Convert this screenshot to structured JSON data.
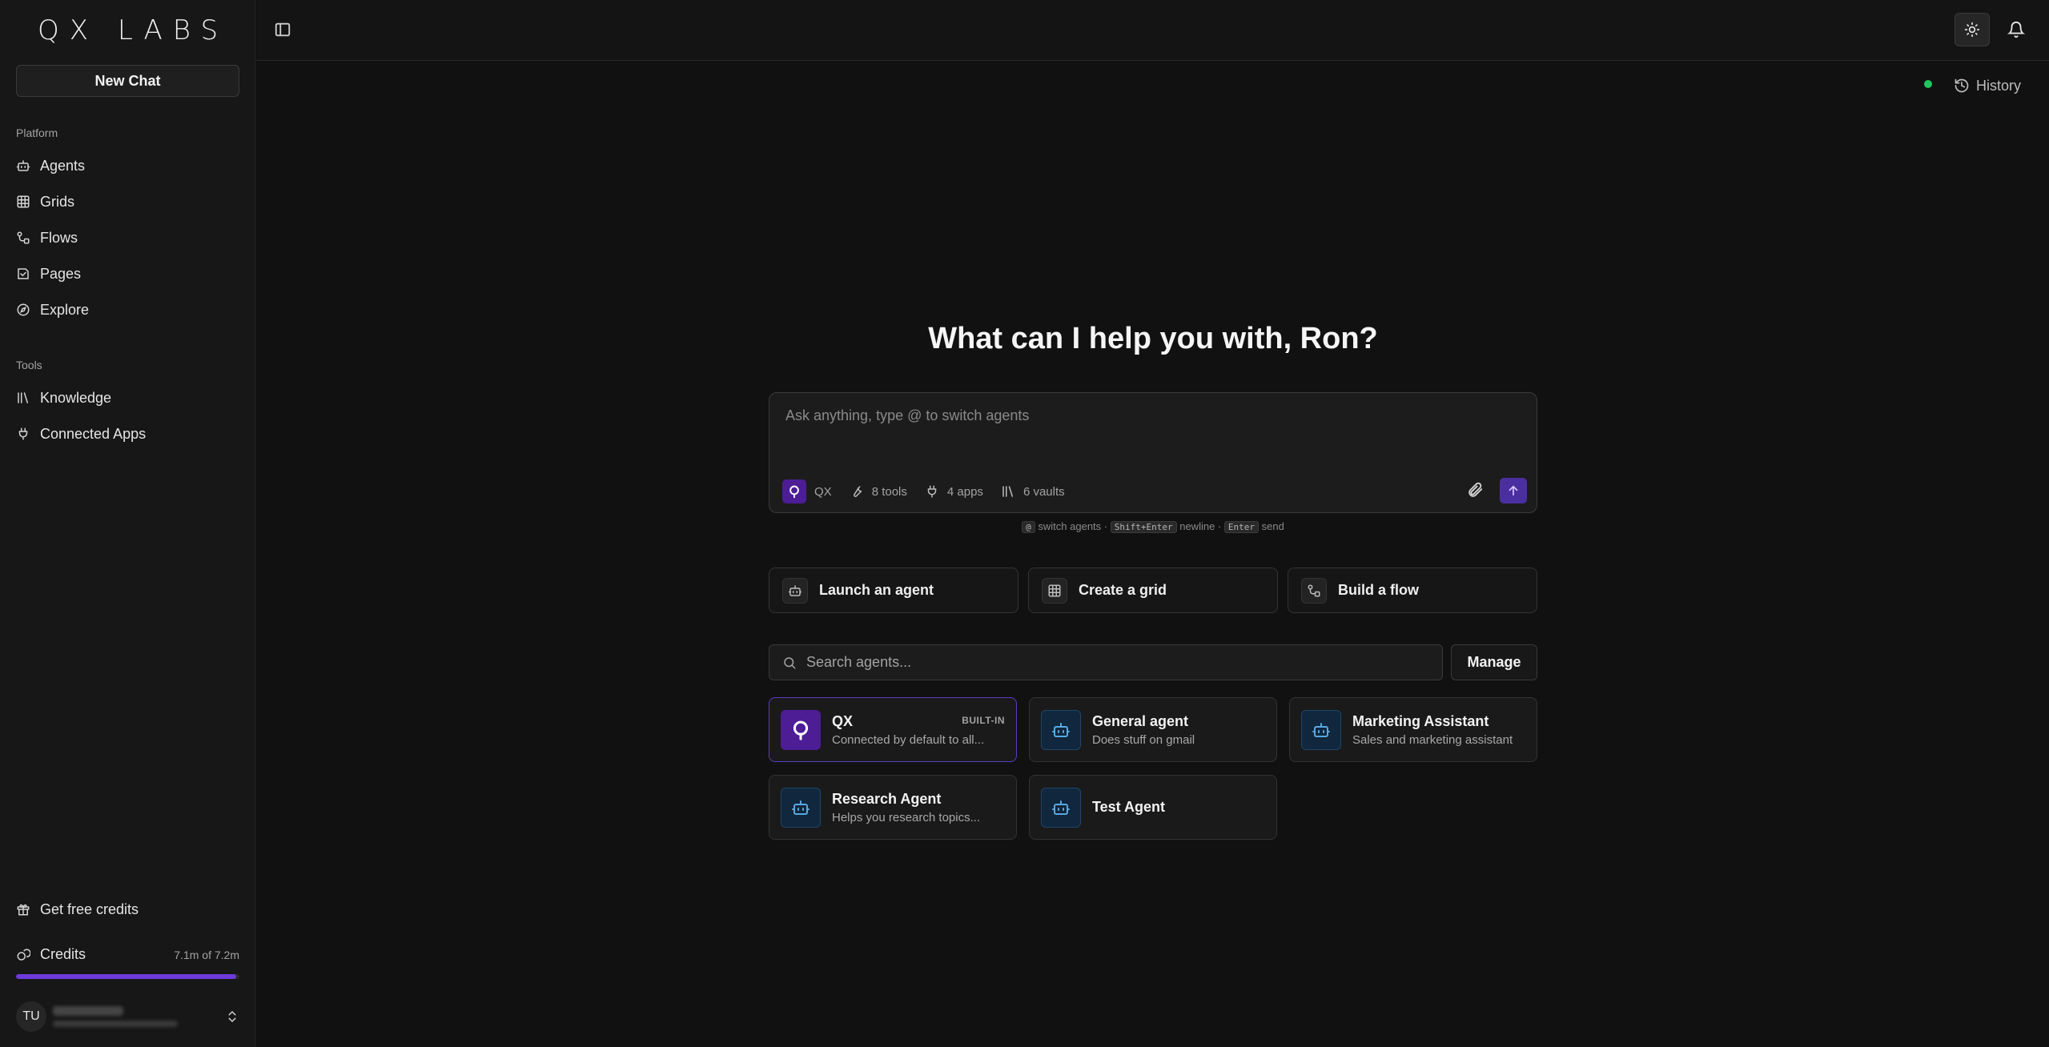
{
  "app": {
    "logo": "QX LABS"
  },
  "sidebar": {
    "new_chat": "New Chat",
    "platform_label": "Platform",
    "platform_items": [
      {
        "label": "Agents",
        "icon": "bot-icon"
      },
      {
        "label": "Grids",
        "icon": "grid-icon"
      },
      {
        "label": "Flows",
        "icon": "flow-icon"
      },
      {
        "label": "Pages",
        "icon": "pages-icon"
      },
      {
        "label": "Explore",
        "icon": "compass-icon"
      }
    ],
    "tools_label": "Tools",
    "tools_items": [
      {
        "label": "Knowledge",
        "icon": "library-icon"
      },
      {
        "label": "Connected Apps",
        "icon": "plug-icon"
      }
    ],
    "free_credits": "Get free credits",
    "credits": {
      "label": "Credits",
      "amount": "7.1m of 7.2m",
      "fraction": 0.986
    },
    "user": {
      "initials": "TU"
    }
  },
  "header": {
    "history": "History"
  },
  "main": {
    "greeting": "What can I help you with, Ron?",
    "composer": {
      "placeholder": "Ask anything, type @ to switch agents",
      "agent": "QX",
      "tools": "8 tools",
      "apps": "4 apps",
      "vaults": "6 vaults"
    },
    "hint": {
      "key_at": "@",
      "switch": "switch agents ·",
      "key_shift": "Shift+Enter",
      "newline": "newline ·",
      "key_enter": "Enter",
      "send": "send"
    },
    "actions": [
      {
        "label": "Launch an agent"
      },
      {
        "label": "Create a grid"
      },
      {
        "label": "Build a flow"
      }
    ],
    "search": {
      "placeholder": "Search agents..."
    },
    "manage": "Manage",
    "agents": [
      {
        "name": "QX",
        "desc": "Connected by default to all...",
        "badge": "BUILT-IN"
      },
      {
        "name": "General agent",
        "desc": "Does stuff on gmail"
      },
      {
        "name": "Marketing Assistant",
        "desc": "Sales and marketing assistant"
      },
      {
        "name": "Research Agent",
        "desc": "Helps you research topics..."
      },
      {
        "name": "Test Agent",
        "desc": ""
      }
    ]
  },
  "colors": {
    "accent": "#6d3bdc",
    "status": "#22c55e",
    "agent_icon": "#5aa7e0"
  }
}
